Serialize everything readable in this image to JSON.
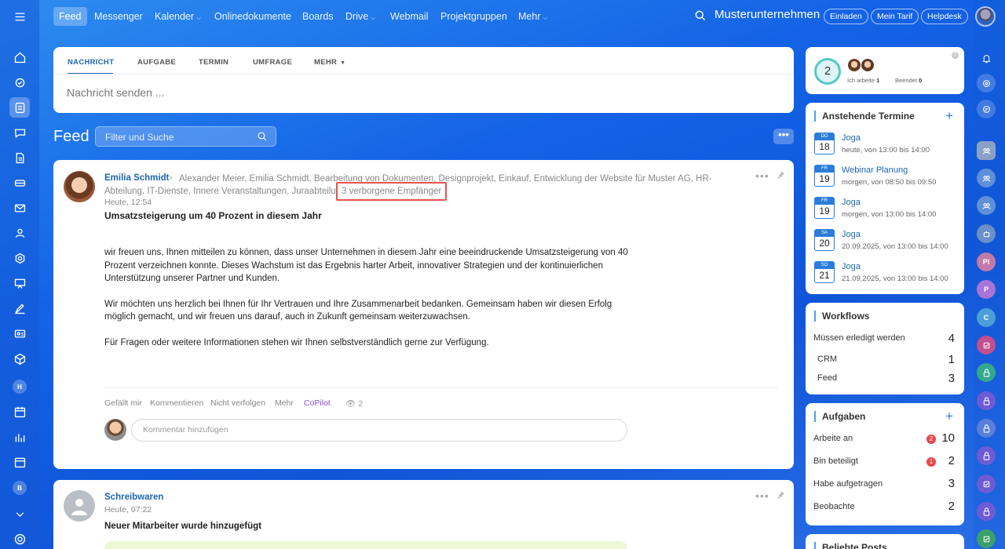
{
  "topnav": {
    "items": [
      "Feed",
      "Messenger",
      "Kalender",
      "Onlinedokumente",
      "Boards",
      "Drive",
      "Webmail",
      "Projektgruppen",
      "Mehr"
    ],
    "company": "Musterunternehmen",
    "buttons": [
      "Einladen",
      "Mein Tarif",
      "Helpdesk"
    ]
  },
  "composer": {
    "tabs": [
      "NACHRICHT",
      "AUFGABE",
      "TERMIN",
      "UMFRAGE",
      "MEHR"
    ],
    "placeholder": "Nachricht senden ..."
  },
  "feed": {
    "title": "Feed",
    "filter_placeholder": "Filter und Suche",
    "more_label": "•••"
  },
  "post1": {
    "author": "Emilia Schmidt",
    "recipients": "Alexander Meier, Emilia Schmidt, Bearbeitung von Dokumenten, Designprojekt, Einkauf, Entwicklung der Website für Muster AG, HR-Abteilung, IT-Dienste, Innere Veranstaltungen, Juraabteilung und noch",
    "hidden_recipients": "3 verborgene Empfänger",
    "time": "Heute, 12:54",
    "subject": "Umsatzsteigerung um 40 Prozent in diesem Jahr",
    "paragraphs": [
      "wir freuen uns, Ihnen mitteilen zu können, dass unser Unternehmen in diesem Jahr eine beeindruckende Umsatzsteigerung von 40 Prozent verzeichnen konnte. Dieses Wachstum ist das Ergebnis harter Arbeit, innovativer Strategien und der kontinuierlichen Unterstützung unserer Partner und Kunden.",
      "Wir möchten uns herzlich bei Ihnen für Ihr Vertrauen und Ihre Zusammenarbeit bedanken. Gemeinsam haben wir diesen Erfolg möglich gemacht, und wir freuen uns darauf, auch in Zukunft gemeinsam weiterzuwachsen.",
      "Für Fragen oder weitere Informationen stehen wir Ihnen selbstverständlich gerne zur Verfügung."
    ],
    "actions": [
      "Gefällt mir",
      "Kommentieren",
      "Nicht verfolgen",
      "Mehr",
      "CoPilot"
    ],
    "views": "2",
    "comment_placeholder": "Kommentar hinzufügen"
  },
  "post2": {
    "author": "Schreibwaren",
    "time": "Heute, 07:22",
    "subject": "Neuer Mitarbeiter wurde hinzugefügt"
  },
  "status_widget": {
    "count": "2",
    "working_label": "Ich arbeite",
    "working_count": "1",
    "done_label": "Beendet",
    "done_count": "0"
  },
  "termine": {
    "title": "Anstehende Termine",
    "events": [
      {
        "day": "DO",
        "date": "18",
        "title": "Joga",
        "time": "heute, von 13:00 bis 14:00"
      },
      {
        "day": "FR",
        "date": "19",
        "title": "Webinar Planung",
        "time": "morgen, von 08:50 bis 09:50"
      },
      {
        "day": "FR",
        "date": "19",
        "title": "Joga",
        "time": "morgen, von 13:00 bis 14:00"
      },
      {
        "day": "SA",
        "date": "20",
        "title": "Joga",
        "time": "20.09.2025, von 13:00 bis 14:00"
      },
      {
        "day": "SO",
        "date": "21",
        "title": "Joga",
        "time": "21.09.2025, von 13:00 bis 14:00"
      }
    ]
  },
  "workflows": {
    "title": "Workflows",
    "rows": [
      {
        "label": "Müssen erledigt werden",
        "value": "4"
      },
      {
        "label": "CRM",
        "value": "1"
      },
      {
        "label": "Feed",
        "value": "3"
      }
    ]
  },
  "aufgaben": {
    "title": "Aufgaben",
    "rows": [
      {
        "label": "Arbeite an",
        "badge": "2",
        "value": "10"
      },
      {
        "label": "Bin beteiligt",
        "badge": "1",
        "value": "2"
      },
      {
        "label": "Habe aufgetragen",
        "badge": "",
        "value": "3"
      },
      {
        "label": "Beobachte",
        "badge": "",
        "value": "2"
      }
    ]
  },
  "beliebte": {
    "title": "Beliebte Posts"
  },
  "left_rail_letters": [
    "H",
    "B"
  ],
  "right_rail_letters": [
    "Pl",
    "P",
    "C"
  ],
  "colors": {
    "accent": "#2066b0",
    "highlight_border": "#e5534b",
    "copilot": "#8a4fd6"
  }
}
